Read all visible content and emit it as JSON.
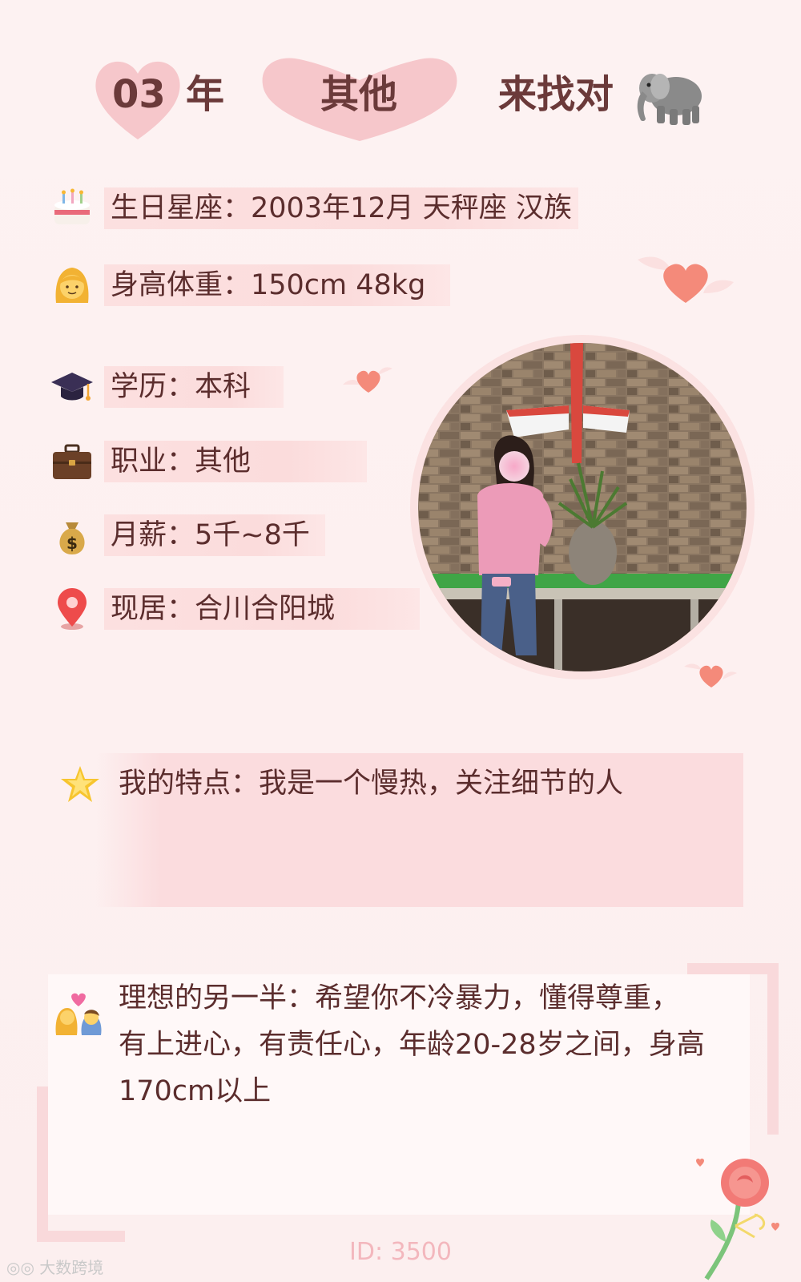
{
  "header": {
    "year_num": "03",
    "year_unit": "年",
    "occupation": "其他",
    "tail": "来找对",
    "tail_icon": "elephant-icon"
  },
  "info": [
    {
      "icon": "birthday-cake-icon",
      "text": "生日星座：2003年12月 天秤座 汉族"
    },
    {
      "icon": "woman-face-icon",
      "text": "身高体重：150cm 48kg"
    },
    {
      "icon": "graduation-cap-icon",
      "text": "学历：本科"
    },
    {
      "icon": "briefcase-icon",
      "text": "职业：其他"
    },
    {
      "icon": "money-bag-icon",
      "text": "月薪：5千~8千"
    },
    {
      "icon": "location-pin-icon",
      "text": "现居：合川合阳城"
    }
  ],
  "feature": {
    "icon": "glowing-star-icon",
    "text": "我的特点：我是一个慢热，关注细节的人"
  },
  "ideal": {
    "icon": "couple-heart-icon",
    "lines": [
      "理想的另一半：希望你不冷暴力，懂得尊重，",
      "有上进心，有责任心，年龄20-28岁之间，身高",
      "170cm以上"
    ]
  },
  "footer": {
    "id_text": "ID: 3500",
    "watermark": "大数跨境"
  },
  "colors": {
    "background": "#fdf1f1",
    "highlight": "#fbdcdc",
    "text": "#5b2d2d",
    "title_text": "#6b3a3a",
    "heart": "#f6c7cb",
    "accent_heart": "#f48a7a",
    "id_text": "#f3b7bd"
  }
}
